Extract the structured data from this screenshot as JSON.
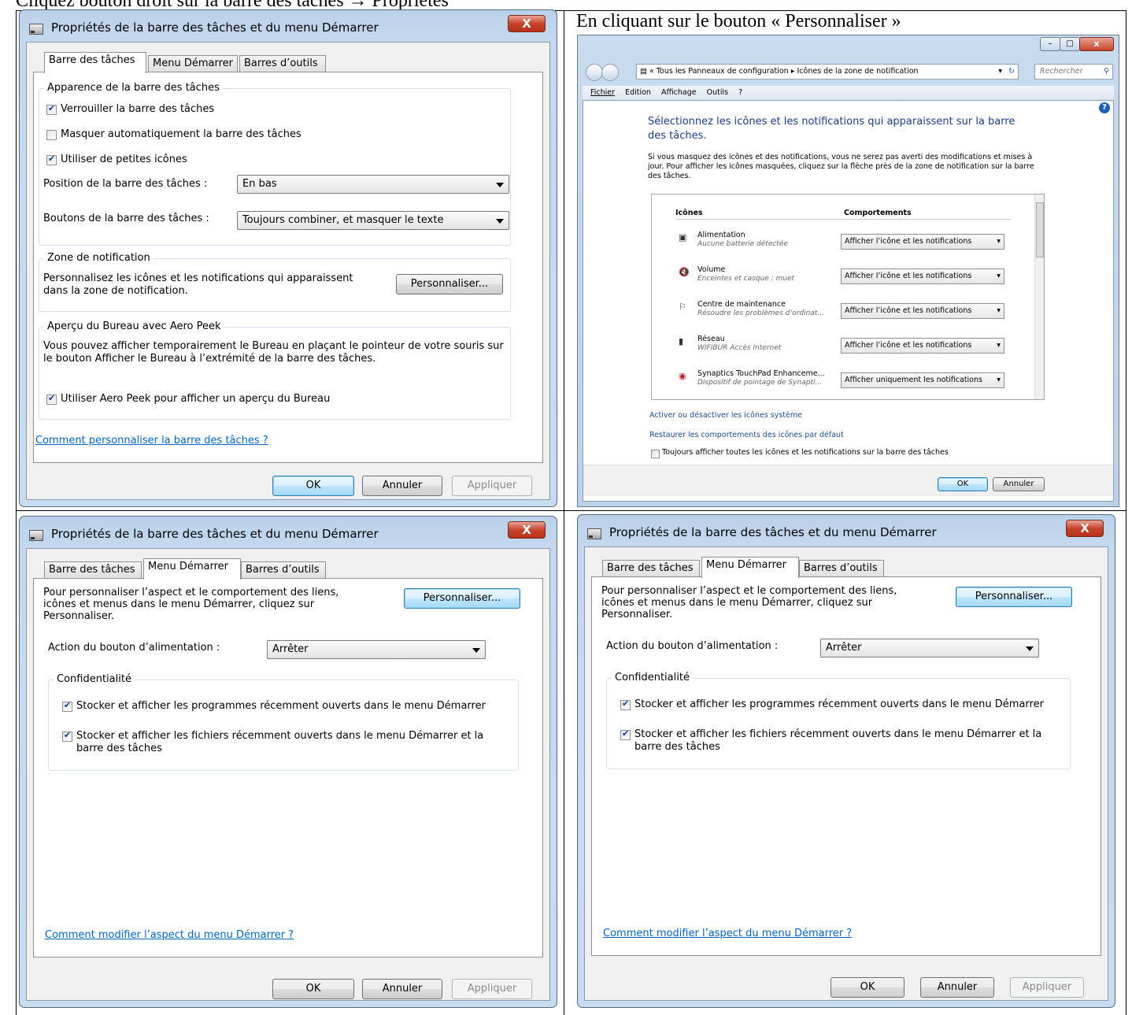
{
  "captions": {
    "top": "Cliquez bouton droit sur la barre des tâches → Propriétés",
    "right_top": "En cliquant sur le bouton « Personnaliser »"
  },
  "dialog_title": "Propriétés de la barre des tâches et du menu Démarrer",
  "close_glyph": "X",
  "tabs": [
    "Barre des tâches",
    "Menu Démarrer",
    "Barres d’outils"
  ],
  "taskbar_tab": {
    "appearance_group": "Apparence de la barre des tâches",
    "lock": "Verrouiller la barre des tâches",
    "autohide": "Masquer automatiquement la barre des tâches",
    "small_icons": "Utiliser de petites icônes",
    "position_label": "Position de la barre des tâches :",
    "position_value": "En bas",
    "buttons_label": "Boutons de la barre des tâches :",
    "buttons_value": "Toujours combiner, et masquer le texte",
    "notif_group": "Zone de notification",
    "notif_text": "Personnalisez les icônes et les notifications qui apparaissent dans la zone de notification.",
    "customize": "Personnaliser...",
    "peek_group": "Aperçu du Bureau avec Aero Peek",
    "peek_text": "Vous pouvez afficher temporairement le Bureau en plaçant le pointeur de votre souris sur le bouton Afficher le Bureau à l’extrémité de la barre des tâches.",
    "peek_check": "Utiliser Aero Peek pour afficher un aperçu du Bureau",
    "help_link": "Comment personnaliser la barre des tâches ?"
  },
  "start_tab": {
    "intro": "Pour personnaliser l’aspect et le comportement des liens, icônes et menus dans le menu Démarrer, cliquez sur Personnaliser.",
    "customize": "Personnaliser...",
    "power_label": "Action du bouton d’alimentation :",
    "power_value": "Arrêter",
    "privacy_group": "Confidentialité",
    "store_programs": "Stocker et afficher les programmes récemment ouverts dans le menu Démarrer",
    "store_files": "Stocker et afficher les fichiers récemment ouverts dans le menu Démarrer et la barre des tâches",
    "help_link": "Comment modifier l’aspect du menu Démarrer ?"
  },
  "buttons": {
    "ok": "OK",
    "cancel": "Annuler",
    "apply": "Appliquer"
  },
  "cpl": {
    "address": "« Tous les Panneaux de configuration ▸ Icônes de la zone de notification",
    "search_placeholder": "Rechercher",
    "menu": [
      "Fichier",
      "Edition",
      "Affichage",
      "Outils",
      "?"
    ],
    "heading": "Sélectionnez les icônes et les notifications qui apparaissent sur la barre des tâches.",
    "info": "Si vous masquez des icônes et des notifications, vous ne serez pas averti des modifications et mises à jour. Pour afficher les icônes masquées, cliquez sur la flèche près de la zone de notification sur la barre des tâches.",
    "col_icons": "Icônes",
    "col_behaviors": "Comportements",
    "rows": [
      {
        "name": "Alimentation",
        "sub": "Aucune batterie détectée",
        "behavior": "Afficher l’icône et les notifications"
      },
      {
        "name": "Volume",
        "sub": "Enceintes et casque : muet",
        "behavior": "Afficher l’icône et les notifications"
      },
      {
        "name": "Centre de maintenance",
        "sub": "Résoudre les problèmes d’ordinat...",
        "behavior": "Afficher l’icône et les notifications"
      },
      {
        "name": "Réseau",
        "sub": "WIFIBUR Accès Internet",
        "behavior": "Afficher l’icône et les notifications"
      },
      {
        "name": "Synaptics TouchPad Enhanceme...",
        "sub": "Dispositif de pointage de Synapti...",
        "behavior": "Afficher uniquement les notifications"
      }
    ],
    "link_system": "Activer ou désactiver les icônes système",
    "link_restore": "Restaurer les comportements des icônes par défaut",
    "always_show": "Toujours afficher toutes les icônes et les notifications sur la barre des tâches",
    "ok": "OK",
    "cancel": "Annuler"
  }
}
